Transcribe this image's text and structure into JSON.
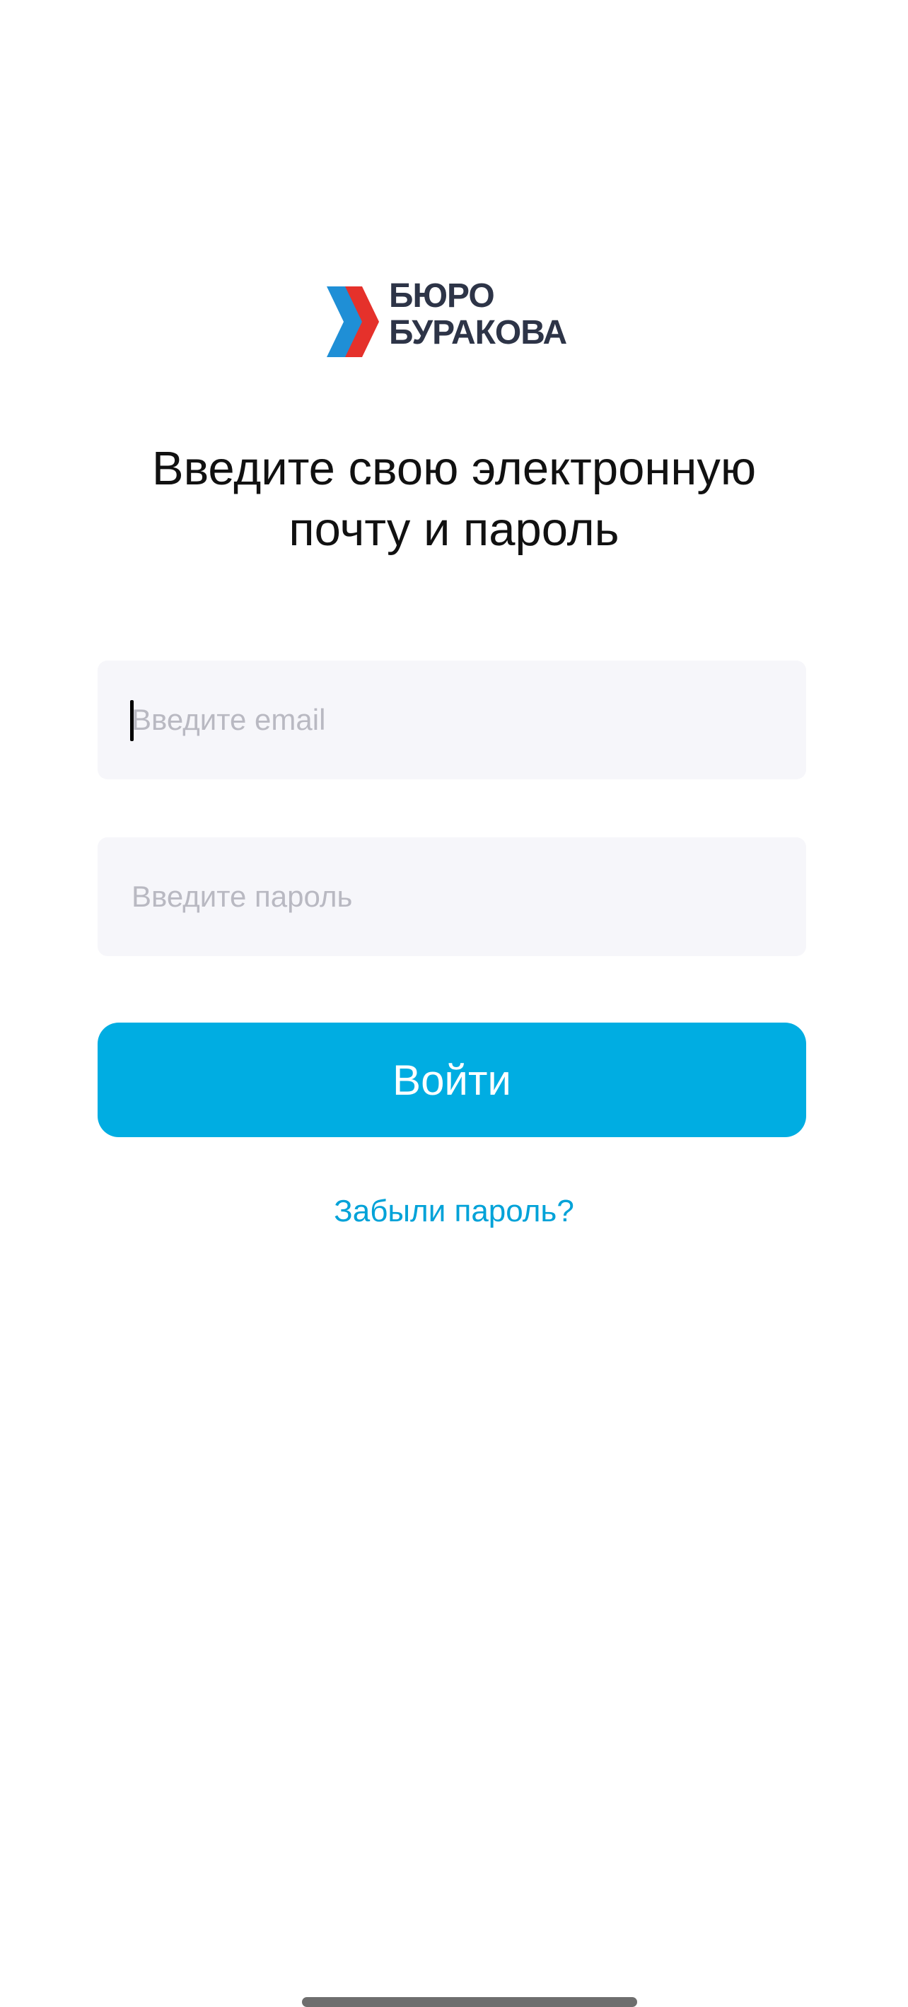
{
  "logo": {
    "line1": "БЮРО",
    "line2": "БУРАКОВА",
    "colors": {
      "text": "#2d3447",
      "red": "#e5312b",
      "blue": "#1f8fd6"
    }
  },
  "title": {
    "line1": "Введите свою электронную",
    "line2": "почту и пароль"
  },
  "email": {
    "placeholder": "Введите email",
    "value": ""
  },
  "password": {
    "placeholder": "Введите пароль",
    "value": ""
  },
  "login_button": {
    "label": "Войти",
    "color": "#00ade2"
  },
  "forgot_link": {
    "label": "Забыли пароль?",
    "color": "#00a2d8"
  }
}
